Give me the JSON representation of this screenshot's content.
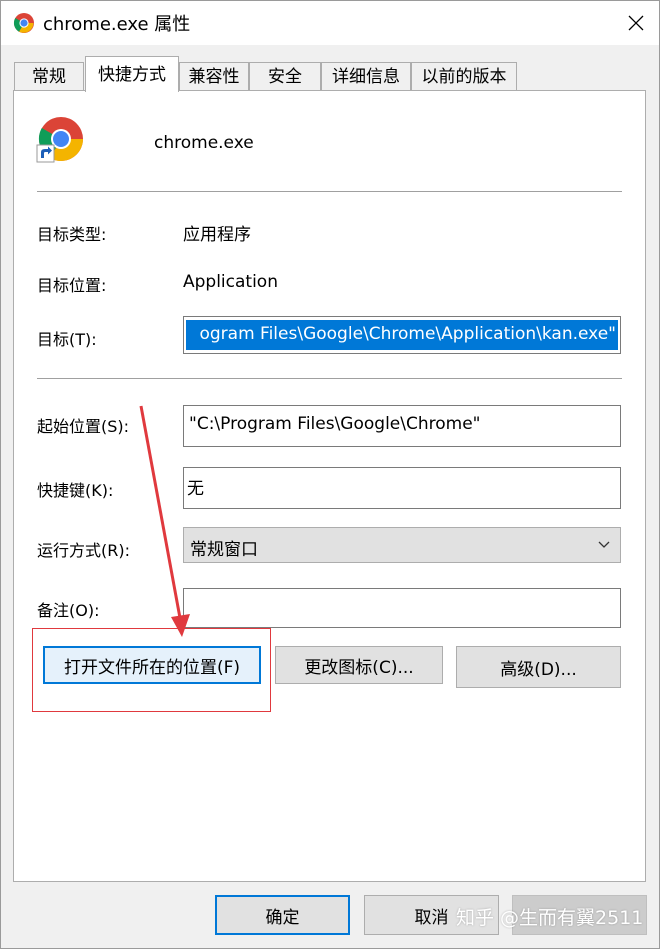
{
  "window": {
    "title": "chrome.exe 属性",
    "close_glyph": "✕"
  },
  "tabs": [
    {
      "label": "常规"
    },
    {
      "label": "快捷方式"
    },
    {
      "label": "兼容性"
    },
    {
      "label": "安全"
    },
    {
      "label": "详细信息"
    },
    {
      "label": "以前的版本"
    }
  ],
  "active_tab": "快捷方式",
  "shortcut": {
    "name": "chrome.exe",
    "target_type_label": "目标类型:",
    "target_type_value": "应用程序",
    "target_location_label": "目标位置:",
    "target_location_value": "Application",
    "target_label": "目标(T):",
    "target_value": "ogram Files\\Google\\Chrome\\Application\\kan.exe\"",
    "start_in_label": "起始位置(S):",
    "start_in_value": "\"C:\\Program Files\\Google\\Chrome\"",
    "hotkey_label": "快捷键(K):",
    "hotkey_value": "无",
    "run_label": "运行方式(R):",
    "run_value": "常规窗口",
    "comment_label": "备注(O):",
    "comment_value": ""
  },
  "buttons": {
    "open_location": "打开文件所在的位置(F)",
    "change_icon": "更改图标(C)...",
    "advanced": "高级(D)...",
    "ok": "确定",
    "cancel": "取消"
  },
  "watermark": "知乎 @生而有翼2511",
  "colors": {
    "selection": "#0078d7",
    "annotation_red": "#e0393e"
  }
}
